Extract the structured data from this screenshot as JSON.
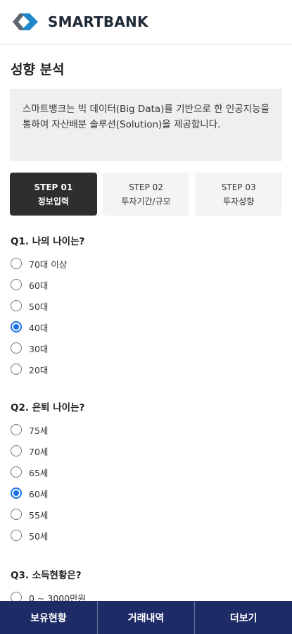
{
  "header": {
    "brand": "SMARTBANK",
    "logo_icon": "chevron-logo-icon"
  },
  "page": {
    "title": "성향 분석"
  },
  "intro": {
    "text": "스마트뱅크는 빅 데이터(Big Data)를 기반으로 한 인공지능을 통하여 자산배분 솔루션(Solution)을 제공합니다."
  },
  "steps": [
    {
      "step": "STEP 01",
      "label": "정보입력",
      "active": true
    },
    {
      "step": "STEP 02",
      "label": "투자기간/규모",
      "active": false
    },
    {
      "step": "STEP 03",
      "label": "투자성향",
      "active": false
    }
  ],
  "questions": [
    {
      "title": "Q1. 나의 나이는?",
      "options": [
        "70대 이상",
        "60대",
        "50대",
        "40대",
        "30대",
        "20대"
      ],
      "selected": "40대"
    },
    {
      "title": "Q2. 은퇴 나이는?",
      "options": [
        "75세",
        "70세",
        "65세",
        "60세",
        "55세",
        "50세"
      ],
      "selected": "60세"
    },
    {
      "title": "Q3. 소득현황은?",
      "options": [
        "0 ~ 3000만원"
      ],
      "selected": ""
    }
  ],
  "bottom_nav": {
    "items": [
      "보유현황",
      "거래내역",
      "더보기"
    ]
  },
  "colors": {
    "nav_bg": "#1d2b67",
    "radio_selected": "#1a73e8",
    "step_active": "#2e2e2e",
    "logo_accent": "#1e88c8"
  }
}
